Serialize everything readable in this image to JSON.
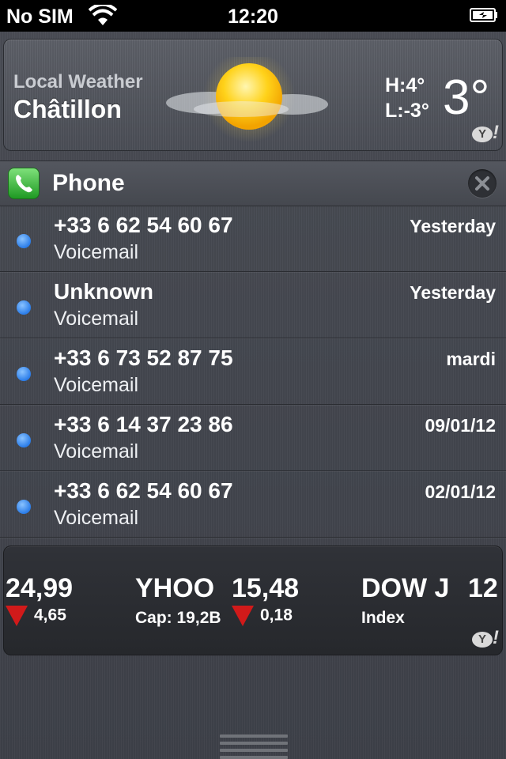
{
  "status_bar": {
    "carrier": "No SIM",
    "time": "12:20"
  },
  "weather": {
    "label": "Local Weather",
    "city": "Châtillon",
    "high": "H:4°",
    "low": "L:-3°",
    "temp": "3°",
    "provider_badge": "Y!"
  },
  "phone": {
    "title": "Phone",
    "items": [
      {
        "title": "+33 6 62 54 60 67",
        "subtitle": "Voicemail",
        "date": "Yesterday"
      },
      {
        "title": "Unknown",
        "subtitle": "Voicemail",
        "date": "Yesterday"
      },
      {
        "title": "+33 6 73 52 87 75",
        "subtitle": "Voicemail",
        "date": "mardi"
      },
      {
        "title": "+33 6 14 37 23 86",
        "subtitle": "Voicemail",
        "date": "09/01/12"
      },
      {
        "title": "+33 6 62 54 60 67",
        "subtitle": "Voicemail",
        "date": "02/01/12"
      }
    ]
  },
  "stocks": {
    "items": [
      {
        "price": "24,99",
        "change": "4,65"
      },
      {
        "symbol": "YHOO",
        "price": "15,48",
        "cap": "Cap: 19,2B",
        "change": "0,18"
      },
      {
        "symbol": "DOW J",
        "price": "12",
        "subtitle": "Index"
      }
    ],
    "provider_badge": "Y!"
  },
  "colors": {
    "accent_blue": "#2b7de9",
    "down_red": "#d11a1a",
    "phone_green": "#1f9a23"
  }
}
